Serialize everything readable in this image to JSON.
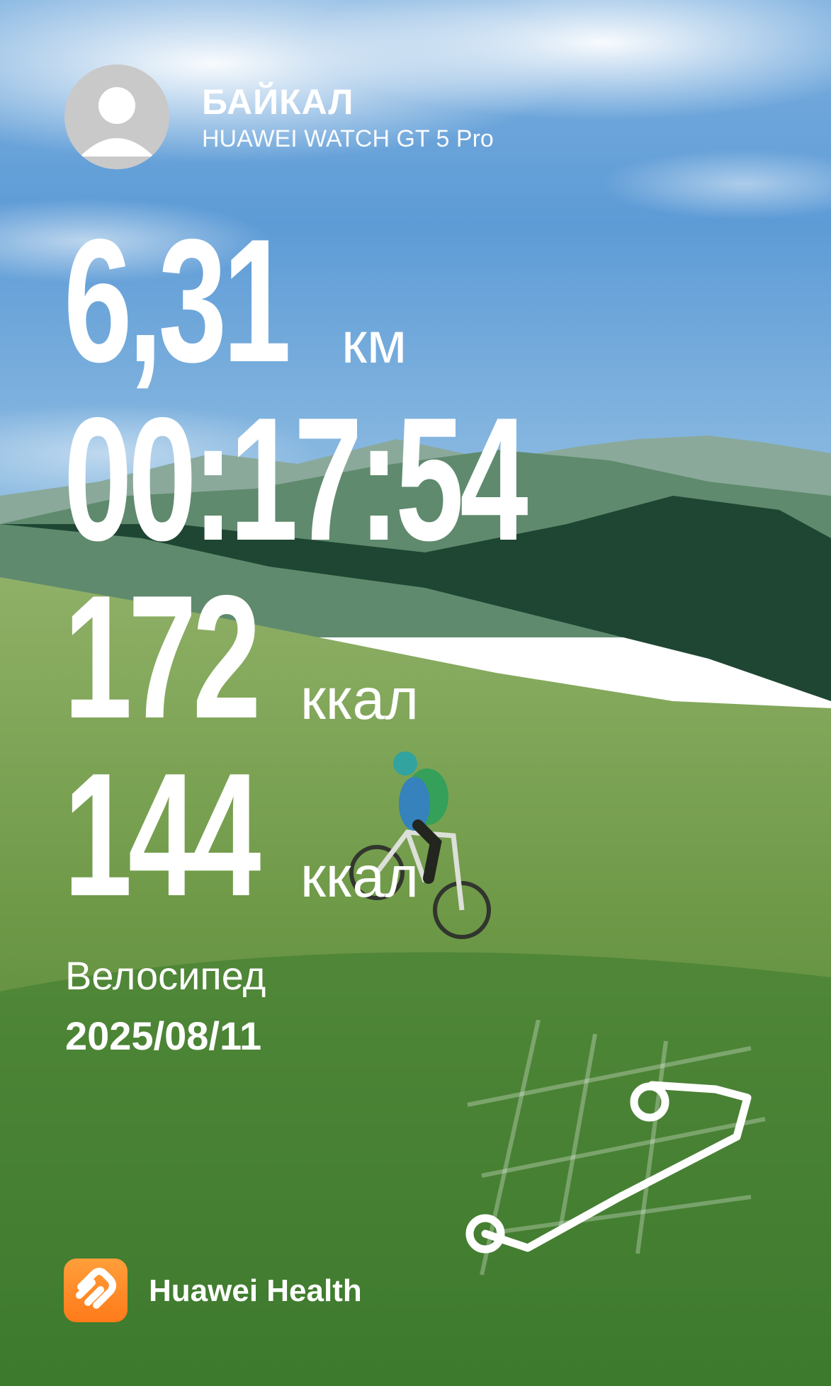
{
  "profile": {
    "name": "БАЙКАЛ",
    "device": "HUAWEI WATCH GT 5 Pro"
  },
  "stats": {
    "distance": {
      "value": "6,31",
      "unit": "км"
    },
    "duration": {
      "value": "00:17:54"
    },
    "calories": {
      "value": "172",
      "unit": "ккал"
    },
    "active_calories": {
      "value": "144",
      "unit": "ккал"
    }
  },
  "activity": {
    "type": "Велосипед",
    "date": "2025/08/11"
  },
  "brand": {
    "name": "Huawei Health",
    "accent": "#ff8a24"
  },
  "background": {
    "sky": "#4f8fcf",
    "mountains": "#6b8f78",
    "forest": "#1f4a34",
    "meadow": "#5b8a3c"
  }
}
